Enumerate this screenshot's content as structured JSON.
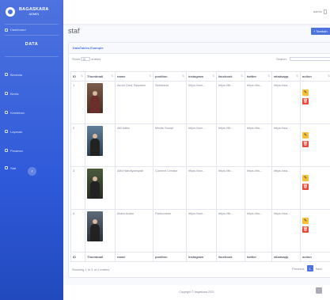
{
  "brand": {
    "title": "BAGASKARA",
    "subtitle": "ADMIN"
  },
  "sidebar": {
    "dashboard": "Dashboard",
    "heading": "DATA",
    "items": [
      {
        "label": "Beranda"
      },
      {
        "label": "Berita"
      },
      {
        "label": "Kelebihan"
      },
      {
        "label": "Layanan"
      },
      {
        "label": "Pesanan"
      },
      {
        "label": "Staf"
      }
    ],
    "toggle": "‹"
  },
  "topbar": {
    "user": "admin"
  },
  "page": {
    "title": "staf",
    "add_button": "+ Tambah"
  },
  "card": {
    "header": "DataTables Example"
  },
  "datatable": {
    "show_prefix": "Show",
    "show_value": "10",
    "show_suffix": "entries",
    "search_label": "Search:",
    "info": "Showing 1 to 4 of 4 entries",
    "prev": "Previous",
    "page": "1",
    "next": "Next"
  },
  "table": {
    "headers": [
      "ID",
      "Thumbnail",
      "name",
      "position",
      "instagram",
      "facebook",
      "twitter",
      "whatsapp",
      "action"
    ],
    "rows": [
      {
        "id": "1",
        "name": "Azuni Dina Sasalani",
        "position": "Selebaria",
        "instagram": "https://ww...",
        "facebook": "https://fb...",
        "twitter": "https://tw...",
        "whatsapp": "https://wa..."
      },
      {
        "id": "2",
        "name": "Alif Adita",
        "position": "Media Sosial",
        "instagram": "https://ww...",
        "facebook": "https://fb...",
        "twitter": "https://tw...",
        "whatsapp": "https://wa..."
      },
      {
        "id": "3",
        "name": "Alfa Handiyansyah",
        "position": "Content Creator",
        "instagram": "https://ww...",
        "facebook": "https://fb...",
        "twitter": "https://tw...",
        "whatsapp": "https://wa..."
      },
      {
        "id": "4",
        "name": "Ilham Adam",
        "position": "Pantominer",
        "instagram": "https://ww...",
        "facebook": "https://fb...",
        "twitter": "https://tw...",
        "whatsapp": "https://wa..."
      }
    ]
  },
  "footer": {
    "text": "Copyright © bagaskara 2021"
  },
  "colors": {
    "primary": "#4e73df",
    "warning": "#f6c23e",
    "danger": "#e74a3b"
  },
  "icons": {
    "edit": "pencil-icon",
    "delete": "trash-icon",
    "sort": "sort-icon"
  }
}
